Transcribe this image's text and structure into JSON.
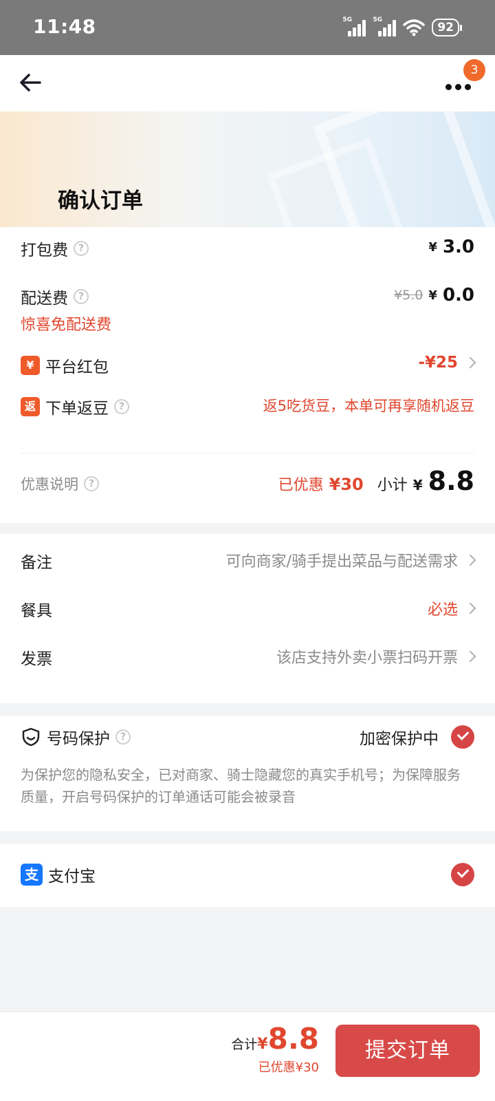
{
  "status_bar": {
    "time": "11:48",
    "sim1": "5G",
    "sim2": "5G",
    "battery": "92"
  },
  "nav": {
    "badge": "3"
  },
  "header": {
    "title": "确认订单"
  },
  "fees": {
    "packing": {
      "label": "打包费",
      "currency": "¥",
      "value": "3.0"
    },
    "delivery": {
      "label": "配送费",
      "original": "¥5.0",
      "currency": "¥",
      "value": "0.0",
      "note": "惊喜免配送费"
    },
    "red_packet": {
      "icon": "¥",
      "label": "平台红包",
      "value": "-¥25"
    },
    "beans": {
      "icon": "返",
      "label": "下单返豆",
      "value": "返5吃货豆，本单可再享随机返豆"
    },
    "summary": {
      "label": "优惠说明",
      "saved_label": "已优惠",
      "saved_amount": "¥30",
      "subtotal_label": "小计",
      "currency": "¥",
      "subtotal": "8.8"
    }
  },
  "options": {
    "remark": {
      "label": "备注",
      "value": "可向商家/骑手提出菜品与配送需求"
    },
    "utensils": {
      "label": "餐具",
      "value": "必选"
    },
    "invoice": {
      "label": "发票",
      "value": "该店支持外卖小票扫码开票"
    }
  },
  "privacy": {
    "label": "号码保护",
    "status": "加密保护中",
    "desc": "为保护您的隐私安全，已对商家、骑士隐藏您的真实手机号；为保障服务质量，开启号码保护的订单通话可能会被录音"
  },
  "payment": {
    "icon": "支",
    "label": "支付宝"
  },
  "footer": {
    "total_label": "合计",
    "currency": "¥",
    "total": "8.8",
    "saved": "已优惠¥30",
    "submit": "提交订单"
  },
  "colors": {
    "accent_red": "#e0472f",
    "button_red": "#d84a48",
    "badge_orange": "#f06a2c",
    "alipay_blue": "#1677ff"
  }
}
